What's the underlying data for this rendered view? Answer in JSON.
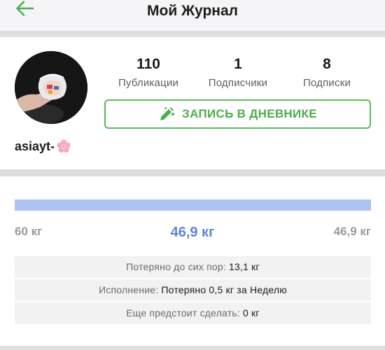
{
  "header": {
    "title": "Мой Журнал",
    "back_icon": "arrow-left-icon",
    "accent_color": "#4cae4c"
  },
  "profile": {
    "username": "asiayt-",
    "username_emoji_icon": "cherry-blossom-icon",
    "avatar_icon": "profile-photo",
    "stats": [
      {
        "value": "110",
        "label": "Публикации"
      },
      {
        "value": "1",
        "label": "Подписчики"
      },
      {
        "value": "8",
        "label": "Подписки"
      }
    ],
    "diary_button": {
      "label": "ЗАПИСЬ В ДНЕВНИКЕ",
      "icon": "pencil-sparkle-icon",
      "color": "#4cae4c"
    }
  },
  "weight": {
    "start": "60 кг",
    "current": "46,9 кг",
    "goal": "46,9 кг",
    "progress_fraction": 1.0,
    "progress_color": "#aec3ef",
    "current_color": "#5b87d4",
    "rows": [
      {
        "label": "Потеряно до сих пор:",
        "value": "13,1 кг"
      },
      {
        "label": "Исполнение:",
        "value": "Потеряно 0,5 кг за Неделю"
      },
      {
        "label": "Еще предстоит сделать:",
        "value": "0 кг"
      }
    ]
  }
}
